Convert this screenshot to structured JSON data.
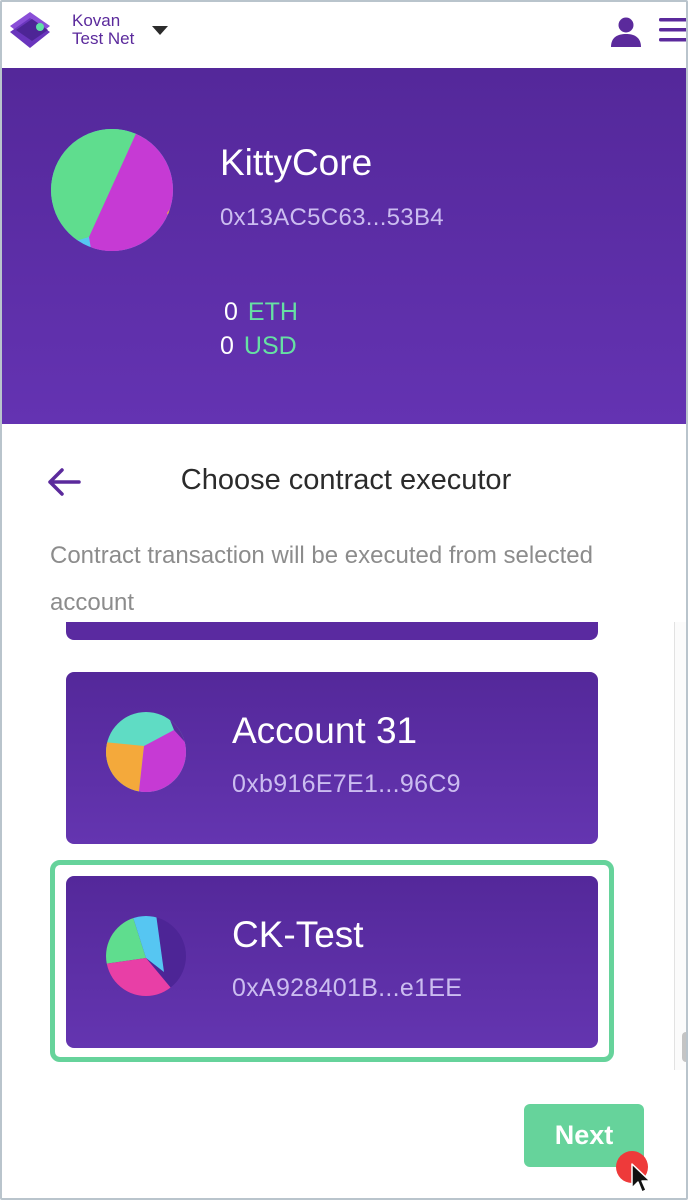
{
  "network": {
    "name_line1": "Kovan",
    "name_line2": "Test Net"
  },
  "contract": {
    "name": "KittyCore",
    "address": "0x13AC5C63...53B4",
    "balances": [
      {
        "amount": "0",
        "unit": "ETH"
      },
      {
        "amount": "0",
        "unit": "USD"
      }
    ]
  },
  "section": {
    "title": "Choose contract executor",
    "description": "Contract transaction will be executed from selected account"
  },
  "accounts": [
    {
      "name": "Account 31",
      "address": "0xb916E7E1...96C9",
      "selected": false
    },
    {
      "name": "CK-Test",
      "address": "0xA928401B...e1EE",
      "selected": true
    }
  ],
  "actions": {
    "next_label": "Next"
  },
  "colors": {
    "primary_purple": "#5b2a9c",
    "accent_green": "#66d39b",
    "address_text": "#cbbdf0"
  },
  "icons": {
    "logo": "wallet-logo-icon",
    "network_dropdown": "caret-down-icon",
    "profile": "user-icon",
    "menu": "hamburger-menu-icon",
    "back": "arrow-left-icon"
  }
}
